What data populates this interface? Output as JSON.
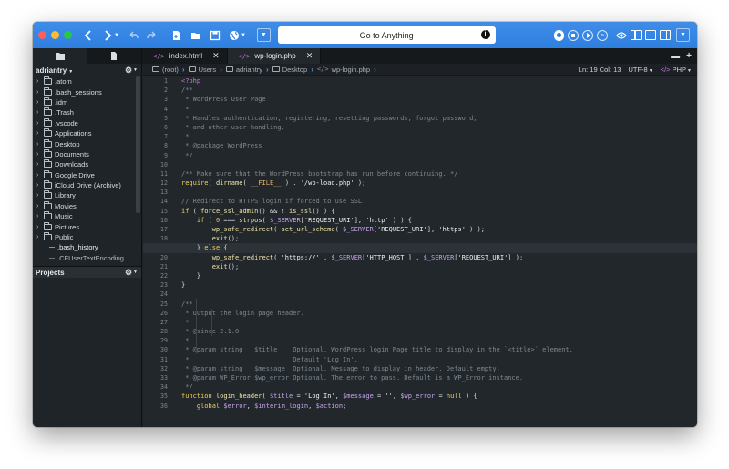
{
  "toolbar": {
    "goto_placeholder": "Go to Anything",
    "goto_info": "i"
  },
  "tabs": [
    {
      "label": "index.html",
      "icon": "code-icon",
      "active": false
    },
    {
      "label": "wp-login.php",
      "icon": "code-icon",
      "active": true
    }
  ],
  "sidebar": {
    "user": "adriantry",
    "projects_label": "Projects",
    "items": [
      {
        "label": ".atom",
        "type": "folder"
      },
      {
        "label": ".bash_sessions",
        "type": "folder"
      },
      {
        "label": ".idm",
        "type": "folder"
      },
      {
        "label": ".Trash",
        "type": "folder"
      },
      {
        "label": ".vscode",
        "type": "folder"
      },
      {
        "label": "Applications",
        "type": "folder"
      },
      {
        "label": "Desktop",
        "type": "folder"
      },
      {
        "label": "Documents",
        "type": "folder"
      },
      {
        "label": "Downloads",
        "type": "folder"
      },
      {
        "label": "Google Drive",
        "type": "folder"
      },
      {
        "label": "iCloud Drive (Archive)",
        "type": "folder"
      },
      {
        "label": "Library",
        "type": "folder"
      },
      {
        "label": "Movies",
        "type": "folder"
      },
      {
        "label": "Music",
        "type": "folder"
      },
      {
        "label": "Pictures",
        "type": "folder"
      },
      {
        "label": "Public",
        "type": "folder"
      },
      {
        "label": ".bash_history",
        "type": "file"
      },
      {
        "label": ".CFUserTextEncoding",
        "type": "file"
      }
    ]
  },
  "breadcrumb": {
    "items": [
      "(root)",
      "Users",
      "adriantry",
      "Desktop",
      "wp-login.php"
    ]
  },
  "status": {
    "position": "Ln: 19 Col: 13",
    "encoding": "UTF-8",
    "language": "PHP"
  },
  "editor": {
    "line_numbers": [
      "1",
      "2",
      "3",
      "4",
      "5",
      "6",
      "7",
      "8",
      "9",
      "10",
      "11",
      "12",
      "13",
      "14",
      "15",
      "16",
      "17",
      "18",
      "19",
      "20",
      "21",
      "22",
      "23",
      "24",
      "25",
      "26",
      "27",
      "28",
      "29",
      "30",
      "31",
      "32",
      "33",
      "34",
      "35",
      "36"
    ],
    "current_line": 19,
    "lines": [
      [
        [
          "tag",
          "<?php"
        ]
      ],
      [
        [
          "cmt",
          "/**"
        ]
      ],
      [
        [
          "cmt",
          " * WordPress User Page"
        ]
      ],
      [
        [
          "cmt",
          " *"
        ]
      ],
      [
        [
          "cmt",
          " * Handles authentication, registering, resetting passwords, forgot password,"
        ]
      ],
      [
        [
          "cmt",
          " * and other user handling."
        ]
      ],
      [
        [
          "cmt",
          " *"
        ]
      ],
      [
        [
          "cmt",
          " * @package WordPress"
        ]
      ],
      [
        [
          "cmt",
          " */"
        ]
      ],
      [
        [
          "pun",
          ""
        ]
      ],
      [
        [
          "cmt",
          "/** Make sure that the WordPress bootstrap has run before continuing. */"
        ]
      ],
      [
        [
          "kw",
          "require"
        ],
        [
          "pun",
          "( "
        ],
        [
          "fn",
          "dirname"
        ],
        [
          "pun",
          "( "
        ],
        [
          "num",
          "__FILE__"
        ],
        [
          "pun",
          " ) . "
        ],
        [
          "str",
          "'/wp-load.php'"
        ],
        [
          "pun",
          " );"
        ]
      ],
      [
        [
          "pun",
          ""
        ]
      ],
      [
        [
          "cmt",
          "// Redirect to HTTPS login if forced to use SSL."
        ]
      ],
      [
        [
          "kw",
          "if"
        ],
        [
          "pun",
          " ( "
        ],
        [
          "fn",
          "force_ssl_admin"
        ],
        [
          "pun",
          "() && ! "
        ],
        [
          "fn",
          "is_ssl"
        ],
        [
          "pun",
          "() ) {"
        ]
      ],
      [
        [
          "pun",
          "    "
        ],
        [
          "kw",
          "if"
        ],
        [
          "pun",
          " ( "
        ],
        [
          "num",
          "0"
        ],
        [
          "pun",
          " === "
        ],
        [
          "fn",
          "strpos"
        ],
        [
          "pun",
          "( "
        ],
        [
          "var",
          "$_SERVER"
        ],
        [
          "pun",
          "["
        ],
        [
          "str",
          "'REQUEST_URI'"
        ],
        [
          "pun",
          "], "
        ],
        [
          "str",
          "'http'"
        ],
        [
          "pun",
          " ) ) {"
        ]
      ],
      [
        [
          "pun",
          "        "
        ],
        [
          "fn",
          "wp_safe_redirect"
        ],
        [
          "pun",
          "( "
        ],
        [
          "fn",
          "set_url_scheme"
        ],
        [
          "pun",
          "( "
        ],
        [
          "var",
          "$_SERVER"
        ],
        [
          "pun",
          "["
        ],
        [
          "str",
          "'REQUEST_URI'"
        ],
        [
          "pun",
          "], "
        ],
        [
          "str",
          "'https'"
        ],
        [
          "pun",
          " ) );"
        ]
      ],
      [
        [
          "pun",
          "        "
        ],
        [
          "fn",
          "exit"
        ],
        [
          "pun",
          "();"
        ]
      ],
      [
        [
          "pun",
          "    } "
        ],
        [
          "kw",
          "else"
        ],
        [
          "pun",
          " {"
        ]
      ],
      [
        [
          "pun",
          "        "
        ],
        [
          "fn",
          "wp_safe_redirect"
        ],
        [
          "pun",
          "( "
        ],
        [
          "str",
          "'https://'"
        ],
        [
          "pun",
          " . "
        ],
        [
          "var",
          "$_SERVER"
        ],
        [
          "pun",
          "["
        ],
        [
          "str",
          "'HTTP_HOST'"
        ],
        [
          "pun",
          "] . "
        ],
        [
          "var",
          "$_SERVER"
        ],
        [
          "pun",
          "["
        ],
        [
          "str",
          "'REQUEST_URI'"
        ],
        [
          "pun",
          "] );"
        ]
      ],
      [
        [
          "pun",
          "        "
        ],
        [
          "fn",
          "exit"
        ],
        [
          "pun",
          "();"
        ]
      ],
      [
        [
          "pun",
          "    }"
        ]
      ],
      [
        [
          "pun",
          "}"
        ]
      ],
      [
        [
          "pun",
          ""
        ]
      ],
      [
        [
          "cmt",
          "/**"
        ]
      ],
      [
        [
          "cmt",
          " * Output the login page header."
        ]
      ],
      [
        [
          "cmt",
          " *"
        ]
      ],
      [
        [
          "cmt",
          " * @since 2.1.0"
        ]
      ],
      [
        [
          "cmt",
          " *"
        ]
      ],
      [
        [
          "cmt",
          " * @param string   $title    Optional. WordPress login Page title to display in the `<title>` element."
        ]
      ],
      [
        [
          "cmt",
          " *                           Default 'Log In'."
        ]
      ],
      [
        [
          "cmt",
          " * @param string   $message  Optional. Message to display in header. Default empty."
        ]
      ],
      [
        [
          "cmt",
          " * @param WP_Error $wp_error Optional. The error to pass. Default is a WP_Error instance."
        ]
      ],
      [
        [
          "cmt",
          " */"
        ]
      ],
      [
        [
          "kw",
          "function"
        ],
        [
          "pun",
          " "
        ],
        [
          "fn",
          "login_header"
        ],
        [
          "pun",
          "( "
        ],
        [
          "var",
          "$title"
        ],
        [
          "pun",
          " = "
        ],
        [
          "str",
          "'Log In'"
        ],
        [
          "pun",
          ", "
        ],
        [
          "var",
          "$message"
        ],
        [
          "pun",
          " = "
        ],
        [
          "str",
          "''"
        ],
        [
          "pun",
          ", "
        ],
        [
          "var",
          "$wp_error"
        ],
        [
          "pun",
          " = "
        ],
        [
          "kw",
          "null"
        ],
        [
          "pun",
          " ) {"
        ]
      ],
      [
        [
          "pun",
          "    "
        ],
        [
          "kw",
          "global"
        ],
        [
          "pun",
          " "
        ],
        [
          "var",
          "$error"
        ],
        [
          "pun",
          ", "
        ],
        [
          "var",
          "$interim_login"
        ],
        [
          "pun",
          ", "
        ],
        [
          "var",
          "$action"
        ],
        [
          "pun",
          ";"
        ]
      ]
    ]
  }
}
